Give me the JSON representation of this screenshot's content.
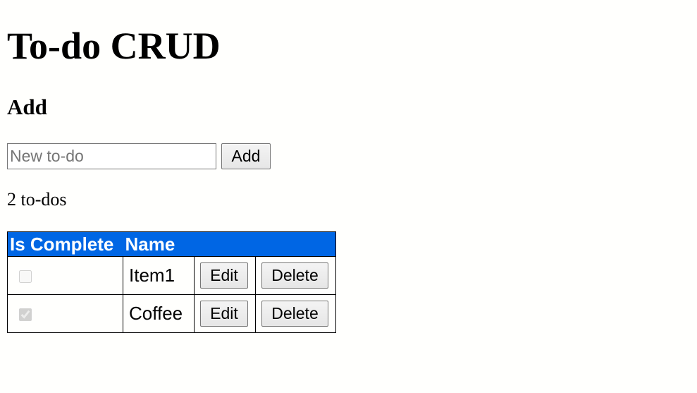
{
  "page": {
    "title": "To-do CRUD"
  },
  "add_section": {
    "heading": "Add",
    "input_placeholder": "New to-do",
    "input_value": "",
    "add_button_label": "Add"
  },
  "summary": {
    "count_text": "2 to-dos"
  },
  "table": {
    "headers": {
      "is_complete": "Is Complete",
      "name": "Name"
    },
    "rows": [
      {
        "is_complete": false,
        "name": "Item1",
        "edit_label": "Edit",
        "delete_label": "Delete"
      },
      {
        "is_complete": true,
        "name": "Coffee",
        "edit_label": "Edit",
        "delete_label": "Delete"
      }
    ]
  },
  "colors": {
    "header_background": "#0066e4",
    "header_text": "#ffffff",
    "page_background": "#fffffd"
  }
}
